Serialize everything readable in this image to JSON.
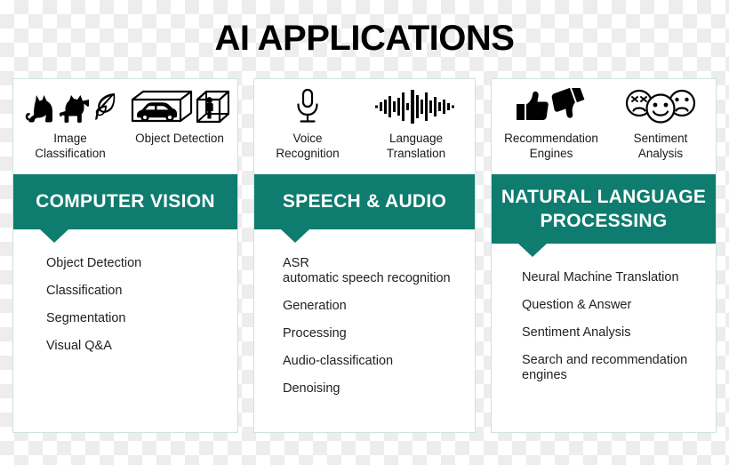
{
  "page": {
    "title": "AI APPLICATIONS",
    "accent_color": "#0e7c6e",
    "card_border_color": "#cfe2df",
    "text_color": "#222222",
    "banner_text_color": "#ffffff"
  },
  "columns": [
    {
      "id": "computer-vision",
      "banner": "COMPUTER VISION",
      "icons": [
        {
          "name": "image-classification-icon",
          "caption": "Image\nClassification",
          "glyphs": [
            "cat",
            "dog",
            "leaf"
          ]
        },
        {
          "name": "object-detection-icon",
          "caption": "Object Detection",
          "glyphs": [
            "car-in-3d-box",
            "person-in-3d-box"
          ]
        }
      ],
      "items": [
        "Object Detection",
        "Classification",
        "Segmentation",
        "Visual Q&A"
      ]
    },
    {
      "id": "speech-and-audio",
      "banner": "SPEECH & AUDIO",
      "icons": [
        {
          "name": "voice-recognition-icon",
          "caption": "Voice\nRecognition",
          "glyphs": [
            "microphone"
          ]
        },
        {
          "name": "language-translation-icon",
          "caption": "Language\nTranslation",
          "glyphs": [
            "audio-waveform"
          ]
        }
      ],
      "items": [
        "ASR\nautomatic speech recognition",
        "Generation",
        "Processing",
        "Audio-classification",
        "Denoising"
      ]
    },
    {
      "id": "natural-language-processing",
      "banner": "NATURAL LANGUAGE\nPROCESSING",
      "icons": [
        {
          "name": "recommendation-engines-icon",
          "caption": "Recommendation\nEngines",
          "glyphs": [
            "thumbs-up",
            "thumbs-down"
          ]
        },
        {
          "name": "sentiment-analysis-icon",
          "caption": "Sentiment\nAnalysis",
          "glyphs": [
            "angry-face",
            "happy-face",
            "sad-face"
          ]
        }
      ],
      "items": [
        "Neural Machine Translation",
        "Question & Answer",
        "Sentiment Analysis",
        "Search and recommendation\nengines"
      ]
    }
  ]
}
